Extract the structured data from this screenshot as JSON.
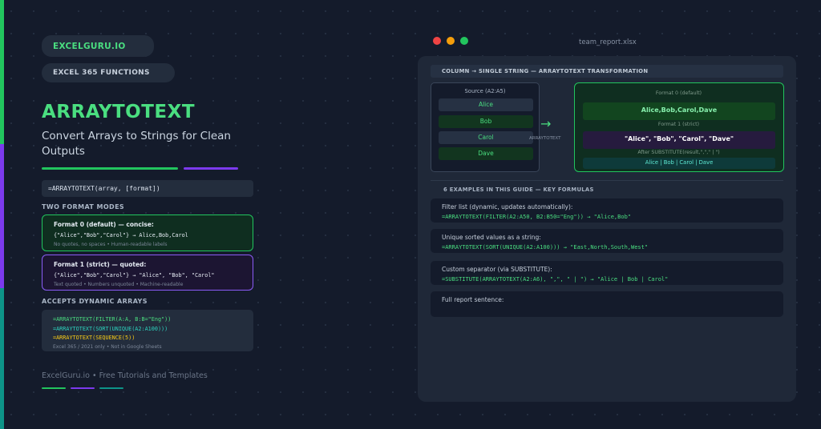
{
  "brand": "EXCELGURU.IO",
  "category": "EXCEL 365 FUNCTIONS",
  "title": "ARRAYTOTEXT",
  "subtitle": "Convert Arrays to Strings for Clean Outputs",
  "syntax": "=ARRAYTOTEXT(array, [format])",
  "modes_heading": "TWO FORMAT MODES",
  "modes": [
    {
      "title": "Format 0 (default) — concise:",
      "example": "{\"Alice\",\"Bob\",\"Carol\"} → Alice,Bob,Carol",
      "note": "No quotes, no spaces • Human-readable labels"
    },
    {
      "title": "Format 1 (strict) — quoted:",
      "example": "{\"Alice\",\"Bob\",\"Carol\"} → \"Alice\", \"Bob\", \"Carol\"",
      "note": "Text quoted • Numbers unquoted • Machine-readable"
    }
  ],
  "dynamic_heading": "ACCEPTS DYNAMIC ARRAYS",
  "dynamic_formulas": [
    "=ARRAYTOTEXT(FILTER(A:A, B:B=\"Eng\"))",
    "=ARRAYTOTEXT(SORT(UNIQUE(A2:A100)))",
    "=ARRAYTOTEXT(SEQUENCE(5))"
  ],
  "dynamic_note": "Excel 365 / 2021 only • Not in Google Sheets",
  "footer": "ExcelGuru.io • Free Tutorials and Templates",
  "colors": {
    "accent_green": "#22c55e",
    "accent_purple": "#7c3aed",
    "accent_teal": "#0d9488",
    "background": "#141b2b"
  },
  "window": {
    "title": "team_report.xlsx",
    "header": "COLUMN → SINGLE STRING — ARRAYTOTEXT TRANSFORMATION",
    "source_title": "Source (A2:A5)",
    "source_items": [
      "Alice",
      "Bob",
      "Carol",
      "Dave"
    ],
    "arrow_label": "ARRAYTOTEXT",
    "arrow_icon": "right-arrow",
    "format0_caption": "Format 0 (default)",
    "format0_result": "Alice,Bob,Carol,Dave",
    "format1_caption": "Format 1 (strict)",
    "format1_result": "\"Alice\", \"Bob\", \"Carol\", \"Dave\"",
    "subst_caption": "After SUBSTITUTE(result,\",\",\" | \")",
    "subst_result": "Alice | Bob | Carol | Dave",
    "examples_heading": "6 EXAMPLES IN THIS GUIDE — KEY FORMULAS",
    "examples": [
      {
        "desc": "Filter list (dynamic, updates automatically):",
        "formula": "=ARRAYTOTEXT(FILTER(A2:A50, B2:B50=\"Eng\")) → \"Alice,Bob\""
      },
      {
        "desc": "Unique sorted values as a string:",
        "formula": "=ARRAYTOTEXT(SORT(UNIQUE(A2:A100))) → \"East,North,South,West\""
      },
      {
        "desc": "Custom separator (via SUBSTITUTE):",
        "formula": "=SUBSTITUTE(ARRAYTOTEXT(A2:A6), \",\", \" | \") → \"Alice | Bob | Carol\""
      },
      {
        "desc": "Full report sentence:",
        "formula": ""
      }
    ]
  }
}
